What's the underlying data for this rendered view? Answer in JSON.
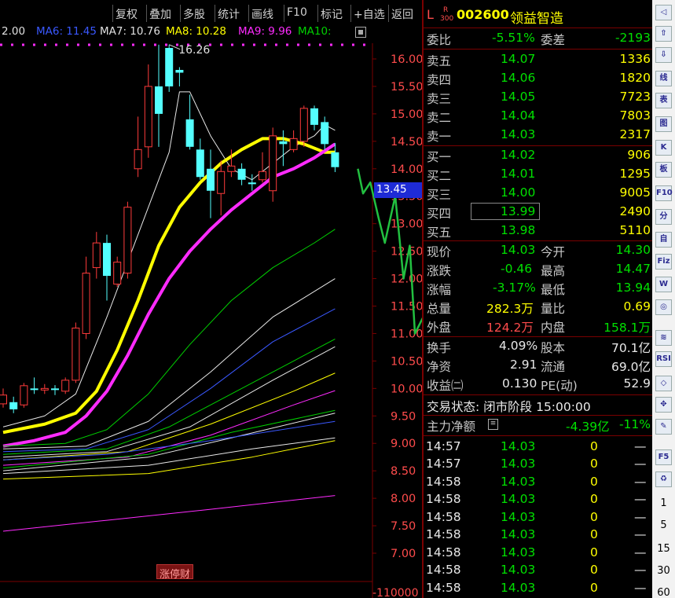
{
  "toolbar": {
    "buttons": [
      "复权",
      "叠加",
      "多股",
      "统计",
      "画线",
      "F10",
      "标记",
      "+自选",
      "返回"
    ]
  },
  "ma_legend": [
    {
      "text": "2.00",
      "color": "#e0e0e0"
    },
    {
      "text": "MA6: 11.45",
      "color": "#3a58ff"
    },
    {
      "text": "MA7: 10.76",
      "color": "#e0e0e0"
    },
    {
      "text": "MA8: 10.28",
      "color": "#ffff00"
    },
    {
      "text": "MA9: 9.96",
      "color": "#ff2bff"
    },
    {
      "text": "MA10:",
      "color": "#00d000"
    }
  ],
  "chart": {
    "high_label": "16.26",
    "current_price_badge": "13.45",
    "y_ticks": [
      "16.00",
      "15.50",
      "15.00",
      "14.50",
      "14.00",
      "13.50",
      "13.00",
      "12.50",
      "12.00",
      "11.50",
      "11.00",
      "10.50",
      "10.00",
      "9.50",
      "9.00",
      "8.50",
      "8.00",
      "7.50",
      "7.00"
    ],
    "volume_label": "-110000",
    "zhangting_label": "涨停财"
  },
  "chart_data": {
    "type": "candlestick",
    "ylim": [
      6.8,
      16.3
    ],
    "y_ticks": [
      16.0,
      15.5,
      15.0,
      14.5,
      14.0,
      13.5,
      13.0,
      12.5,
      12.0,
      11.5,
      11.0,
      10.5,
      10.0,
      9.5,
      9.0,
      8.5,
      8.0,
      7.5,
      7.0
    ],
    "candles": [
      {
        "o": 9.72,
        "c": 9.88,
        "h": 10.0,
        "l": 9.65
      },
      {
        "o": 9.75,
        "c": 9.62,
        "h": 9.85,
        "l": 9.55
      },
      {
        "o": 9.7,
        "c": 10.05,
        "h": 10.1,
        "l": 9.65
      },
      {
        "o": 10.0,
        "c": 9.98,
        "h": 10.2,
        "l": 9.9
      },
      {
        "o": 9.98,
        "c": 10.0,
        "h": 10.08,
        "l": 9.9
      },
      {
        "o": 10.0,
        "c": 9.98,
        "h": 10.06,
        "l": 9.88
      },
      {
        "o": 9.95,
        "c": 10.15,
        "h": 10.2,
        "l": 9.9
      },
      {
        "o": 10.15,
        "c": 11.1,
        "h": 11.2,
        "l": 10.1
      },
      {
        "o": 11.0,
        "c": 12.1,
        "h": 12.4,
        "l": 10.9
      },
      {
        "o": 12.2,
        "c": 12.65,
        "h": 12.85,
        "l": 12.0
      },
      {
        "o": 12.65,
        "c": 12.05,
        "h": 12.8,
        "l": 11.6
      },
      {
        "o": 11.9,
        "c": 12.3,
        "h": 12.4,
        "l": 11.85
      },
      {
        "o": 12.1,
        "c": 13.3,
        "h": 13.4,
        "l": 12.0
      },
      {
        "o": 14.0,
        "c": 14.35,
        "h": 14.95,
        "l": 13.85
      },
      {
        "o": 14.4,
        "c": 15.5,
        "h": 15.9,
        "l": 14.2
      },
      {
        "o": 15.5,
        "c": 15.0,
        "h": 16.26,
        "l": 14.4
      },
      {
        "o": 16.2,
        "c": 15.5,
        "h": 16.26,
        "l": 15.4
      },
      {
        "o": 15.8,
        "c": 15.75,
        "h": 15.85,
        "l": 15.5
      },
      {
        "o": 14.9,
        "c": 14.4,
        "h": 15.35,
        "l": 14.35
      },
      {
        "o": 14.35,
        "c": 13.85,
        "h": 14.55,
        "l": 13.8
      },
      {
        "o": 14.0,
        "c": 13.6,
        "h": 14.35,
        "l": 13.1
      },
      {
        "o": 13.55,
        "c": 13.95,
        "h": 14.15,
        "l": 13.15
      },
      {
        "o": 13.95,
        "c": 14.05,
        "h": 14.35,
        "l": 13.85
      },
      {
        "o": 14.0,
        "c": 13.8,
        "h": 14.1,
        "l": 13.7
      },
      {
        "o": 13.75,
        "c": 13.72,
        "h": 13.9,
        "l": 13.6
      },
      {
        "o": 13.8,
        "c": 13.95,
        "h": 14.3,
        "l": 13.75
      },
      {
        "o": 13.6,
        "c": 14.6,
        "h": 14.75,
        "l": 13.4
      },
      {
        "o": 14.5,
        "c": 14.45,
        "h": 14.7,
        "l": 14.05
      },
      {
        "o": 14.35,
        "c": 14.55,
        "h": 14.7,
        "l": 14.3
      },
      {
        "o": 14.5,
        "c": 15.1,
        "h": 15.15,
        "l": 14.4
      },
      {
        "o": 15.1,
        "c": 14.8,
        "h": 15.15,
        "l": 14.7
      },
      {
        "o": 14.85,
        "c": 14.45,
        "h": 14.95,
        "l": 14.35
      },
      {
        "o": 14.3,
        "c": 14.03,
        "h": 14.47,
        "l": 13.94
      }
    ],
    "ma_lines": [
      {
        "name": "MA-white-short",
        "color": "#e8e8e8",
        "width": 1,
        "values": [
          [
            0,
            9.3
          ],
          [
            4,
            9.5
          ],
          [
            7,
            9.9
          ],
          [
            10,
            11.3
          ],
          [
            12,
            12.3
          ],
          [
            14,
            13.3
          ],
          [
            16,
            14.3
          ],
          [
            17,
            15.4
          ],
          [
            18,
            15.4
          ],
          [
            19,
            15.0
          ],
          [
            20,
            14.6
          ],
          [
            22,
            14.0
          ],
          [
            24,
            13.8
          ],
          [
            26,
            14.1
          ],
          [
            28,
            14.4
          ],
          [
            30,
            14.6
          ],
          [
            31,
            14.8
          ],
          [
            32,
            14.7
          ]
        ]
      },
      {
        "name": "MA-yellow",
        "color": "#ffff00",
        "width": 4,
        "values": [
          [
            0,
            9.2
          ],
          [
            4,
            9.35
          ],
          [
            7,
            9.55
          ],
          [
            9,
            9.95
          ],
          [
            11,
            10.7
          ],
          [
            13,
            11.6
          ],
          [
            15,
            12.6
          ],
          [
            17,
            13.3
          ],
          [
            19,
            13.75
          ],
          [
            21,
            14.1
          ],
          [
            23,
            14.35
          ],
          [
            25,
            14.55
          ],
          [
            27,
            14.55
          ],
          [
            29,
            14.45
          ],
          [
            31,
            14.3
          ],
          [
            32,
            14.3
          ]
        ]
      },
      {
        "name": "MA-magenta",
        "color": "#ff2bff",
        "width": 4,
        "values": [
          [
            0,
            8.95
          ],
          [
            3,
            9.05
          ],
          [
            6,
            9.2
          ],
          [
            8,
            9.5
          ],
          [
            10,
            9.95
          ],
          [
            12,
            10.6
          ],
          [
            14,
            11.35
          ],
          [
            16,
            12.0
          ],
          [
            18,
            12.5
          ],
          [
            20,
            12.9
          ],
          [
            22,
            13.25
          ],
          [
            24,
            13.55
          ],
          [
            26,
            13.85
          ],
          [
            28,
            14.0
          ],
          [
            30,
            14.2
          ],
          [
            32,
            14.45
          ]
        ]
      },
      {
        "name": "MA-green",
        "color": "#00d000",
        "width": 1,
        "values": [
          [
            0,
            8.95
          ],
          [
            6,
            9.0
          ],
          [
            10,
            9.25
          ],
          [
            14,
            9.9
          ],
          [
            18,
            10.8
          ],
          [
            22,
            11.6
          ],
          [
            26,
            12.2
          ],
          [
            30,
            12.65
          ],
          [
            32,
            12.9
          ]
        ]
      },
      {
        "name": "MA-white2",
        "color": "#e8e8e8",
        "width": 1,
        "values": [
          [
            0,
            8.9
          ],
          [
            8,
            8.95
          ],
          [
            14,
            9.4
          ],
          [
            20,
            10.3
          ],
          [
            26,
            11.3
          ],
          [
            32,
            12.0
          ]
        ]
      },
      {
        "name": "MA-blue",
        "color": "#3a58ff",
        "width": 1,
        "values": [
          [
            0,
            8.85
          ],
          [
            8,
            8.9
          ],
          [
            14,
            9.25
          ],
          [
            20,
            10.0
          ],
          [
            26,
            10.85
          ],
          [
            32,
            11.45
          ]
        ]
      },
      {
        "name": "MA-green2",
        "color": "#00d000",
        "width": 1,
        "values": [
          [
            0,
            8.8
          ],
          [
            10,
            8.9
          ],
          [
            16,
            9.3
          ],
          [
            22,
            9.9
          ],
          [
            28,
            10.5
          ],
          [
            32,
            10.9
          ]
        ]
      },
      {
        "name": "MA-white3",
        "color": "#e8e8e8",
        "width": 1,
        "values": [
          [
            0,
            8.75
          ],
          [
            10,
            8.85
          ],
          [
            18,
            9.3
          ],
          [
            26,
            10.15
          ],
          [
            32,
            10.76
          ]
        ]
      },
      {
        "name": "MA-yellow2",
        "color": "#ffff00",
        "width": 1,
        "values": [
          [
            0,
            8.7
          ],
          [
            12,
            8.85
          ],
          [
            20,
            9.35
          ],
          [
            28,
            9.95
          ],
          [
            32,
            10.28
          ]
        ]
      },
      {
        "name": "MA-magenta2",
        "color": "#ff2bff",
        "width": 1,
        "values": [
          [
            0,
            8.6
          ],
          [
            12,
            8.75
          ],
          [
            20,
            9.15
          ],
          [
            28,
            9.7
          ],
          [
            32,
            9.96
          ]
        ]
      },
      {
        "name": "MA-green3",
        "color": "#00d000",
        "width": 1,
        "values": [
          [
            0,
            8.55
          ],
          [
            14,
            8.8
          ],
          [
            22,
            9.2
          ],
          [
            32,
            9.6
          ]
        ]
      },
      {
        "name": "MA-white4",
        "color": "#e8e8e8",
        "width": 1,
        "values": [
          [
            0,
            8.5
          ],
          [
            14,
            8.75
          ],
          [
            22,
            9.1
          ],
          [
            32,
            9.55
          ]
        ]
      },
      {
        "name": "MA-blue2",
        "color": "#3a58ff",
        "width": 1,
        "values": [
          [
            0,
            8.7
          ],
          [
            10,
            8.8
          ],
          [
            20,
            9.05
          ],
          [
            32,
            9.4
          ]
        ]
      },
      {
        "name": "MA-white5",
        "color": "#e8e8e8",
        "width": 1,
        "values": [
          [
            0,
            8.45
          ],
          [
            14,
            8.6
          ],
          [
            24,
            8.9
          ],
          [
            32,
            9.1
          ]
        ]
      },
      {
        "name": "MA-yellow3",
        "color": "#ffff00",
        "width": 1,
        "values": [
          [
            0,
            8.35
          ],
          [
            14,
            8.45
          ],
          [
            24,
            8.75
          ],
          [
            32,
            9.05
          ]
        ]
      },
      {
        "name": "MA-magenta-long",
        "color": "#ff2bff",
        "width": 1,
        "values": [
          [
            0,
            7.4
          ],
          [
            10,
            7.6
          ],
          [
            20,
            7.8
          ],
          [
            32,
            8.05
          ]
        ]
      }
    ],
    "hand_drawn_projection": [
      [
        14.0,
        34.2
      ],
      [
        13.55,
        34.7
      ],
      [
        13.75,
        35.4
      ],
      [
        13.1,
        36.2
      ],
      [
        12.65,
        36.8
      ],
      [
        13.5,
        37.8
      ],
      [
        12.0,
        38.6
      ],
      [
        12.6,
        39.2
      ],
      [
        11.0,
        39.7
      ],
      [
        11.3,
        40.5
      ],
      [
        11.9,
        40.9
      ],
      [
        10.95,
        41.2
      ]
    ]
  },
  "quote": {
    "prefix": "L",
    "badge_top": "R",
    "badge_bottom": "300",
    "code": "002600",
    "name": "领益智造",
    "weibi_label": "委比",
    "weibi_value": "-5.51%",
    "weicha_label": "委差",
    "weicha_value": "-2193",
    "asks": [
      {
        "label": "卖五",
        "price": "14.07",
        "volume": "1336"
      },
      {
        "label": "卖四",
        "price": "14.06",
        "volume": "1820"
      },
      {
        "label": "卖三",
        "price": "14.05",
        "volume": "7723"
      },
      {
        "label": "卖二",
        "price": "14.04",
        "volume": "7803"
      },
      {
        "label": "卖一",
        "price": "14.03",
        "volume": "2317"
      }
    ],
    "bids": [
      {
        "label": "买一",
        "price": "14.02",
        "volume": "906"
      },
      {
        "label": "买二",
        "price": "14.01",
        "volume": "1295"
      },
      {
        "label": "买三",
        "price": "14.00",
        "volume": "9005"
      },
      {
        "label": "买四",
        "price": "13.99",
        "volume": "2490"
      },
      {
        "label": "买五",
        "price": "13.98",
        "volume": "5110"
      }
    ],
    "stats": [
      {
        "l1": "现价",
        "v1": "14.03",
        "l2": "今开",
        "v2": "14.30"
      },
      {
        "l1": "涨跌",
        "v1": "-0.46",
        "l2": "最高",
        "v2": "14.47"
      },
      {
        "l1": "涨幅",
        "v1": "-3.17%",
        "l2": "最低",
        "v2": "13.94"
      },
      {
        "l1": "总量",
        "v1": "282.3万",
        "l2": "量比",
        "v2": "0.69"
      },
      {
        "l1": "外盘",
        "v1": "124.2万",
        "l2": "内盘",
        "v2": "158.1万"
      }
    ],
    "fundamentals": [
      {
        "l1": "换手",
        "v1": "4.09%",
        "l2": "股本",
        "v2": "70.1亿"
      },
      {
        "l1": "净资",
        "v1": "2.91",
        "l2": "流通",
        "v2": "69.0亿"
      },
      {
        "l1": "收益㈡",
        "v1": "0.130",
        "l2": "PE(动)",
        "v2": "52.9"
      }
    ],
    "status": "交易状态: 闭市阶段 15:00:00",
    "main_flow_label": "主力净额",
    "main_flow_value": "-4.39亿",
    "main_flow_pct": "-11%",
    "ticks": [
      {
        "time": "14:57",
        "price": "14.03",
        "volume": "0",
        "flag": "—"
      },
      {
        "time": "14:57",
        "price": "14.03",
        "volume": "0",
        "flag": "—"
      },
      {
        "time": "14:58",
        "price": "14.03",
        "volume": "0",
        "flag": "—"
      },
      {
        "time": "14:58",
        "price": "14.03",
        "volume": "0",
        "flag": "—"
      },
      {
        "time": "14:58",
        "price": "14.03",
        "volume": "0",
        "flag": "—"
      },
      {
        "time": "14:58",
        "price": "14.03",
        "volume": "0",
        "flag": "—"
      },
      {
        "time": "14:58",
        "price": "14.03",
        "volume": "0",
        "flag": "—"
      },
      {
        "time": "14:58",
        "price": "14.03",
        "volume": "0",
        "flag": "—"
      },
      {
        "time": "14:58",
        "price": "14.03",
        "volume": "0",
        "flag": "—"
      }
    ]
  },
  "tool_strip": {
    "tools": [
      "◁",
      "⇧",
      "⇩",
      "线",
      "表",
      "图",
      "K",
      "板",
      "F10",
      "分",
      "自",
      "Fiz",
      "W",
      "◎",
      "≋",
      "RSI",
      "◇",
      "✥",
      "✎",
      "F5",
      "♻"
    ],
    "periods": [
      "1",
      "5",
      "15",
      "30",
      "60"
    ]
  }
}
